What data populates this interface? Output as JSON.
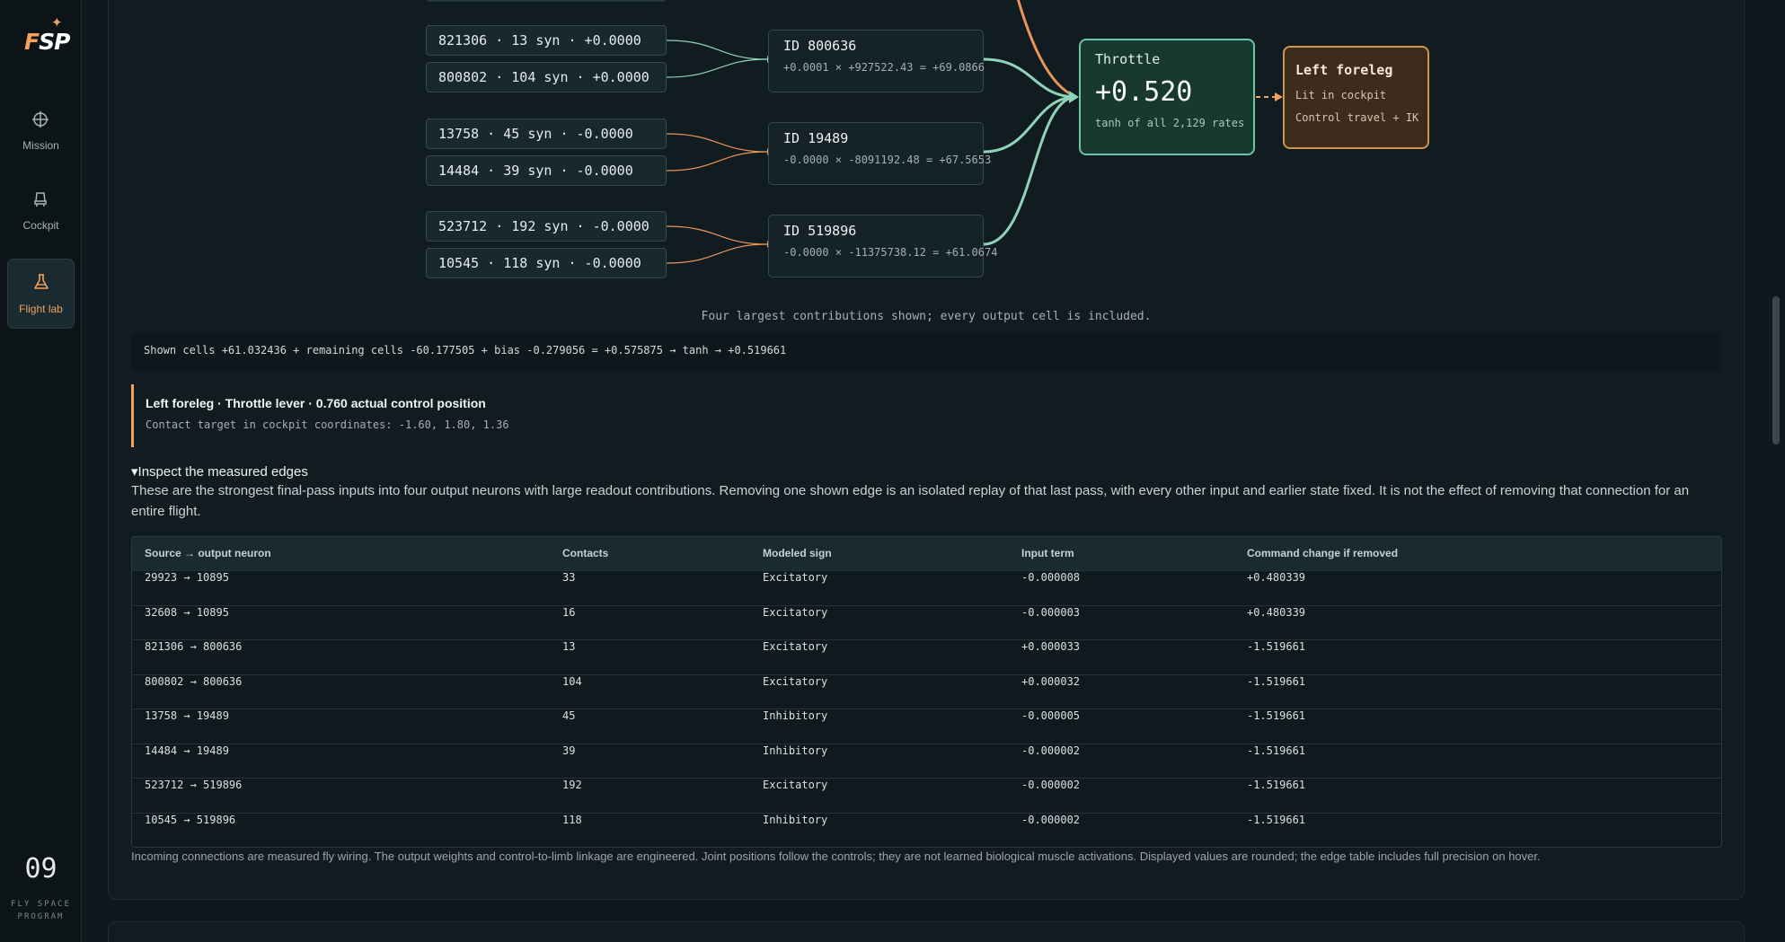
{
  "brand": {
    "logo_text_f": "F",
    "logo_text_rest": "SP",
    "version": "09",
    "program": "FLY SPACE PROGRAM"
  },
  "nav": [
    {
      "label": "Mission",
      "icon": "crosshair-icon",
      "active": false
    },
    {
      "label": "Cockpit",
      "icon": "seat-icon",
      "active": false
    },
    {
      "label": "Flight lab",
      "icon": "flask-icon",
      "active": true
    }
  ],
  "graph": {
    "sources": [
      "821306 · 13 syn · +0.0000",
      "800802 · 104 syn · +0.0000",
      "13758 · 45 syn · -0.0000",
      "14484 · 39 syn · -0.0000",
      "523712 · 192 syn · -0.0000",
      "10545 · 118 syn · -0.0000"
    ],
    "intermediates": [
      {
        "title": "ID 800636",
        "formula": "+0.0001 × +927522.43 = +69.0866"
      },
      {
        "title": "ID 19489",
        "formula": "-0.0000 × -8091192.48 = +67.5653"
      },
      {
        "title": "ID 519896",
        "formula": "-0.0000 × -11375738.12 = +61.0674"
      }
    ],
    "output": {
      "title": "Throttle",
      "value": "+0.520",
      "subtitle": "tanh of all 2,129 rates"
    },
    "limb": {
      "title": "Left foreleg",
      "line1": "Lit in cockpit",
      "line2": "Control travel + IK"
    },
    "colors": {
      "excitatory": "#8fd3b8",
      "inhibitory": "#e8955a",
      "output_border": "#6cc6a6",
      "limb_border": "#d0954f"
    }
  },
  "caption": "Four largest contributions shown; every output cell is included.",
  "formula": "Shown cells +61.032436 + remaining cells -60.177505 + bias -0.279056 = +0.575875 → tanh → +0.519661",
  "callout": {
    "heading": "Left foreleg · Throttle lever · 0.760 actual control position",
    "sub": "Contact target in cockpit coordinates: -1.60, 1.80, 1.36"
  },
  "details": {
    "summary": "Inspect the measured edges",
    "description": "These are the strongest final-pass inputs into four output neurons with large readout contributions. Removing one shown edge is an isolated replay of that last pass, with every other input and earlier state fixed. It is not the effect of removing that connection for an entire flight."
  },
  "table": {
    "headers": [
      "Source → output neuron",
      "Contacts",
      "Modeled sign",
      "Input term",
      "Command change if removed"
    ],
    "rows": [
      [
        "29923 → 10895",
        "33",
        "Excitatory",
        "-0.000008",
        "+0.480339"
      ],
      [
        "32608 → 10895",
        "16",
        "Excitatory",
        "-0.000003",
        "+0.480339"
      ],
      [
        "821306 → 800636",
        "13",
        "Excitatory",
        "+0.000033",
        "-1.519661"
      ],
      [
        "800802 → 800636",
        "104",
        "Excitatory",
        "+0.000032",
        "-1.519661"
      ],
      [
        "13758 → 19489",
        "45",
        "Inhibitory",
        "-0.000005",
        "-1.519661"
      ],
      [
        "14484 → 19489",
        "39",
        "Inhibitory",
        "-0.000002",
        "-1.519661"
      ],
      [
        "523712 → 519896",
        "192",
        "Excitatory",
        "-0.000002",
        "-1.519661"
      ],
      [
        "10545 → 519896",
        "118",
        "Inhibitory",
        "-0.000002",
        "-1.519661"
      ]
    ]
  },
  "footnote": "Incoming connections are measured fly wiring. The output weights and control-to-limb linkage are engineered. Joint positions follow the controls; they are not learned biological muscle activations. Displayed values are rounded; the edge table includes full precision on hover."
}
